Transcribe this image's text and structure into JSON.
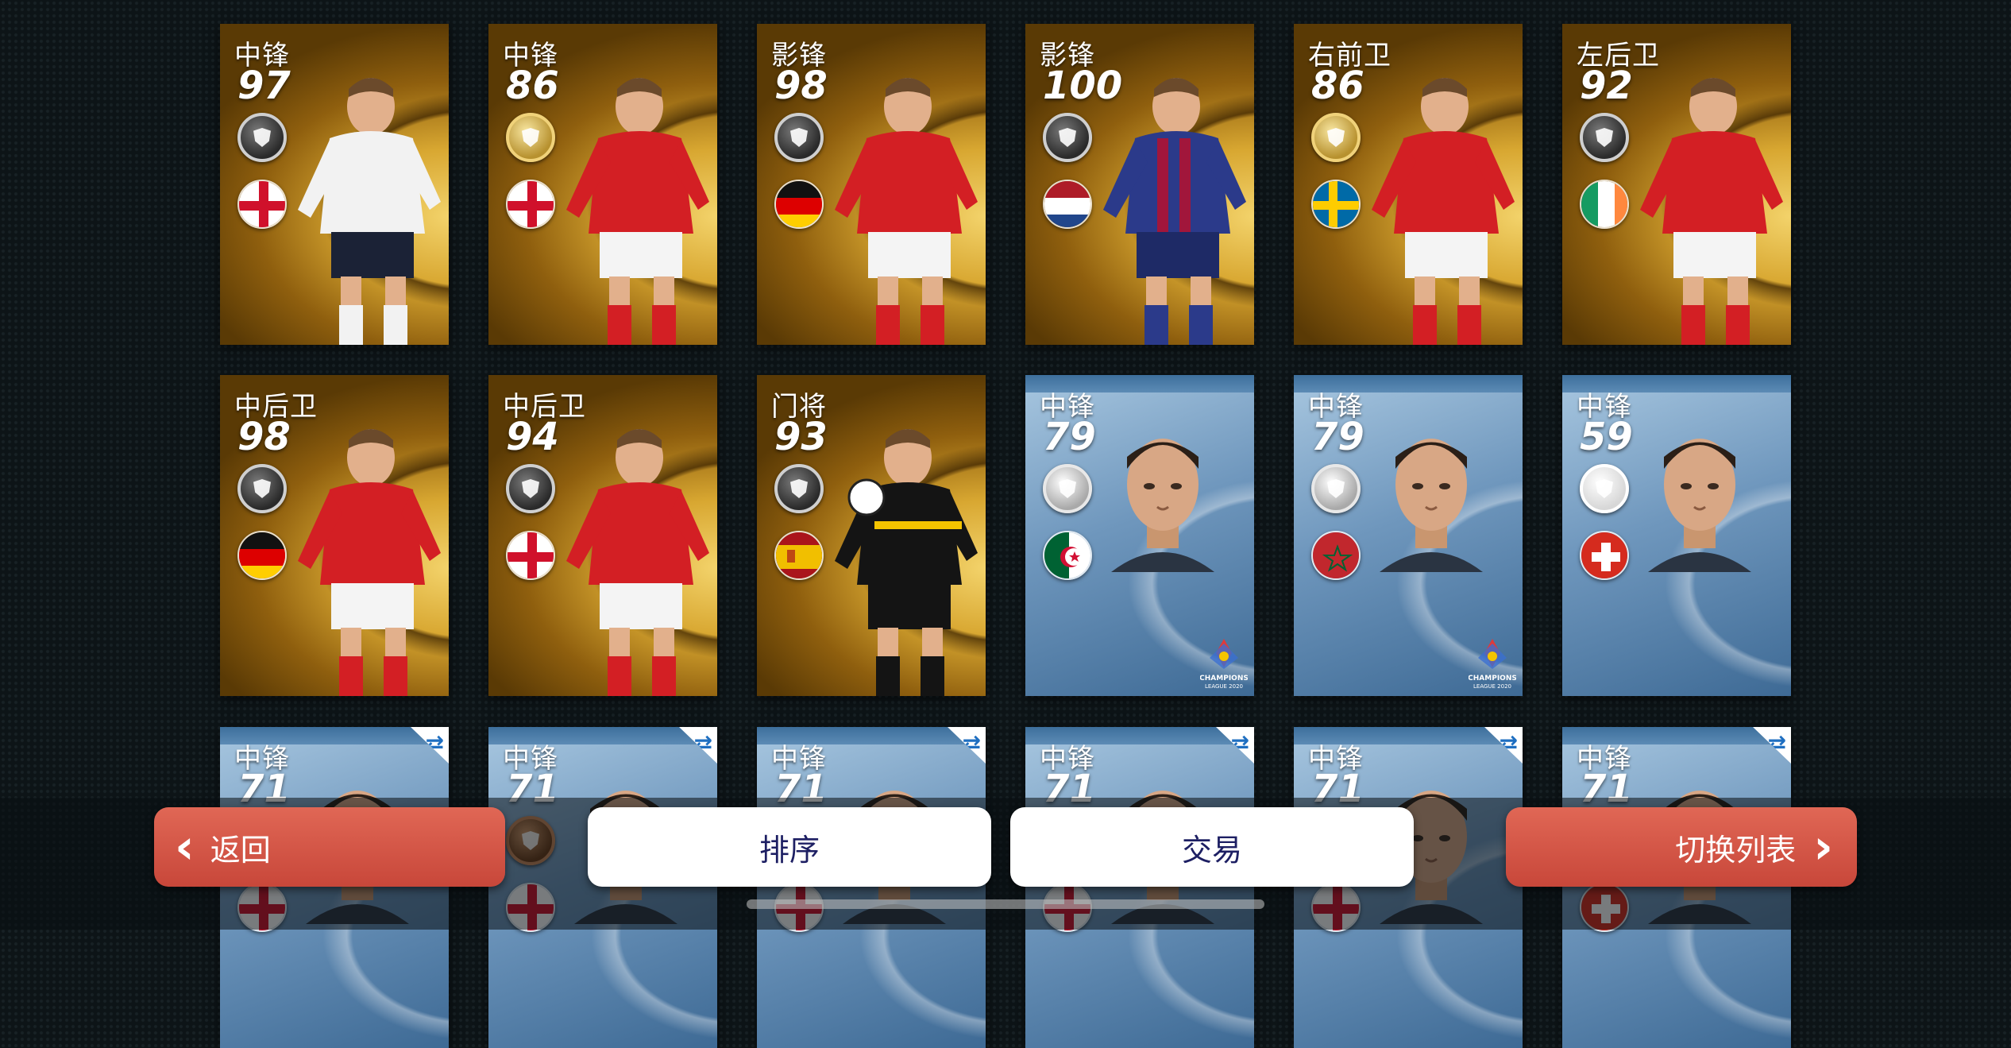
{
  "cards": [
    {
      "pos": "中锋",
      "rating": "97",
      "style": "gold",
      "badge": "dark",
      "flag": "england",
      "art": "white-kit"
    },
    {
      "pos": "中锋",
      "rating": "86",
      "style": "gold",
      "badge": "gold",
      "flag": "england",
      "art": "red-kit"
    },
    {
      "pos": "影锋",
      "rating": "98",
      "style": "gold",
      "badge": "dark",
      "flag": "germany",
      "art": "red-kit"
    },
    {
      "pos": "影锋",
      "rating": "100",
      "style": "gold",
      "badge": "dark",
      "flag": "netherlands",
      "art": "blaugrana-kit"
    },
    {
      "pos": "右前卫",
      "rating": "86",
      "style": "gold",
      "badge": "gold",
      "flag": "sweden",
      "art": "red-kit"
    },
    {
      "pos": "左后卫",
      "rating": "92",
      "style": "gold",
      "badge": "dark",
      "flag": "ireland",
      "art": "red-kit"
    },
    {
      "pos": "中后卫",
      "rating": "98",
      "style": "gold",
      "badge": "dark",
      "flag": "germany",
      "art": "red-kit"
    },
    {
      "pos": "中后卫",
      "rating": "94",
      "style": "gold",
      "badge": "dark",
      "flag": "england",
      "art": "red-kit"
    },
    {
      "pos": "门将",
      "rating": "93",
      "style": "gold",
      "badge": "dark",
      "flag": "spain",
      "art": "keeper-kit"
    },
    {
      "pos": "中锋",
      "rating": "79",
      "style": "blue",
      "badge": "silver",
      "flag": "algeria",
      "art": "face",
      "league": true
    },
    {
      "pos": "中锋",
      "rating": "79",
      "style": "blue",
      "badge": "silver",
      "flag": "morocco",
      "art": "face",
      "league": true
    },
    {
      "pos": "中锋",
      "rating": "59",
      "style": "blue",
      "badge": "white",
      "flag": "switzerland",
      "art": "face"
    },
    {
      "pos": "中锋",
      "rating": "71",
      "style": "blue",
      "badge": "dark",
      "flag": "england",
      "art": "face",
      "transfer": true
    },
    {
      "pos": "中锋",
      "rating": "71",
      "style": "blue",
      "badge": "bronze",
      "flag": "england",
      "art": "face",
      "transfer": true
    },
    {
      "pos": "中锋",
      "rating": "71",
      "style": "blue",
      "badge": "dark",
      "flag": "england",
      "art": "face",
      "transfer": true
    },
    {
      "pos": "中锋",
      "rating": "71",
      "style": "blue",
      "badge": "dark",
      "flag": "england",
      "art": "face",
      "transfer": true
    },
    {
      "pos": "中锋",
      "rating": "71",
      "style": "blue",
      "badge": "dark",
      "flag": "england",
      "art": "face",
      "transfer": true
    },
    {
      "pos": "中锋",
      "rating": "71",
      "style": "blue",
      "badge": "dark",
      "flag": "switzerland",
      "art": "face",
      "transfer": true
    }
  ],
  "buttons": {
    "back": "返回",
    "sort": "排序",
    "trade": "交易",
    "switch_list": "切换列表"
  },
  "colors": {
    "gold_card": "#d8a731",
    "blue_card": "#6f97bd",
    "red_button": "#d45546",
    "white_button_text": "#1d1f63"
  },
  "icons": {
    "back": "chevron-left-icon",
    "switch": "chevron-right-icon",
    "transfer": "transfer-arrows-icon"
  }
}
